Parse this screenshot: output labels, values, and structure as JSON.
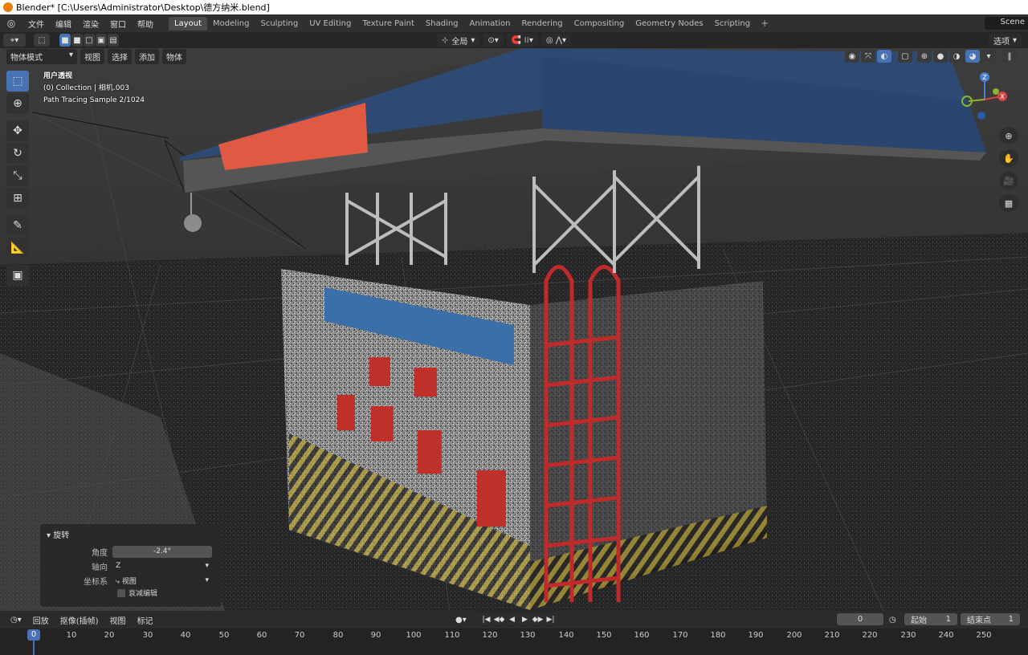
{
  "window": {
    "title": "Blender* [C:\\Users\\Administrator\\Desktop\\德方纳米.blend]"
  },
  "menubar": {
    "menus": [
      "文件",
      "编辑",
      "渲染",
      "窗口",
      "帮助"
    ],
    "workspaces": [
      "Layout",
      "Modeling",
      "Sculpting",
      "UV Editing",
      "Texture Paint",
      "Shading",
      "Animation",
      "Rendering",
      "Compositing",
      "Geometry Nodes",
      "Scripting"
    ],
    "active_workspace": "Layout",
    "scene": "Scene"
  },
  "toolheader": {
    "orientation": "全局",
    "options": "选项"
  },
  "viewport_header": {
    "mode": "物体模式",
    "menus": [
      "视图",
      "选择",
      "添加",
      "物体"
    ]
  },
  "overlay": {
    "view_name": "用户透视",
    "collection": "(0) Collection | 相机.003",
    "sample": "Path Tracing Sample 2/1024"
  },
  "gizmo": {
    "x_label": "X",
    "y_label": "Y",
    "z_label": "Z"
  },
  "redo_panel": {
    "title": "旋转",
    "angle_label": "角度",
    "angle_value": "-2.4°",
    "axis_label": "轴向",
    "axis_value": "Z",
    "orient_label": "坐标系",
    "orient_value": "视图",
    "proportional_label": "衰减编辑"
  },
  "timeline": {
    "menus": [
      "回放",
      "抠像(插帧)",
      "视图",
      "标记"
    ],
    "current_frame": "0",
    "start_label": "起始",
    "start_value": "1",
    "end_label": "结束点",
    "end_value": "1",
    "ticks": [
      "10",
      "20",
      "30",
      "40",
      "50",
      "60",
      "70",
      "80",
      "90",
      "100",
      "110",
      "120",
      "130",
      "140",
      "150",
      "160",
      "170",
      "180",
      "190",
      "200",
      "210",
      "220",
      "230",
      "240",
      "250"
    ],
    "playhead": "0"
  },
  "colors": {
    "accent": "#4772b3",
    "header_bg": "#303030",
    "roof_blue": "#2e4a73",
    "sign_red": "#e05a43"
  }
}
